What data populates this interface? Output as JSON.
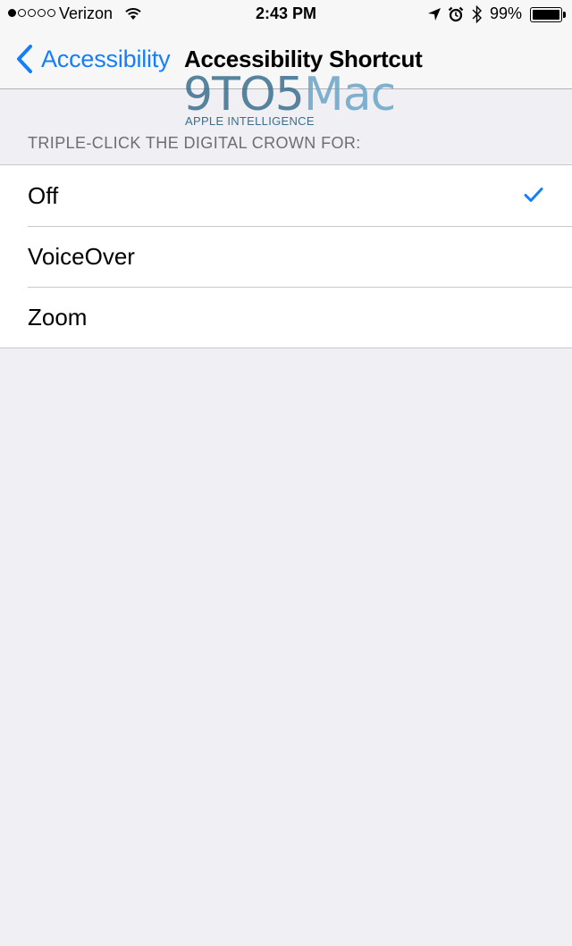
{
  "status_bar": {
    "carrier": "Verizon",
    "signal_bars_filled": 1,
    "signal_bars_total": 5,
    "time": "2:43 PM",
    "battery_percent": "99%",
    "battery_level": 0.99,
    "icons": [
      "signal-dots-icon",
      "wifi-icon",
      "location-arrow-icon",
      "alarm-clock-icon",
      "bluetooth-icon",
      "battery-icon"
    ]
  },
  "nav": {
    "back_label": "Accessibility",
    "title": "Accessibility Shortcut",
    "back_icon": "chevron-left-icon"
  },
  "watermark": {
    "main_prefix": "9TO5",
    "main_suffix": "Mac",
    "sub": "APPLE INTELLIGENCE"
  },
  "section": {
    "header": "TRIPLE-CLICK THE DIGITAL CROWN FOR:"
  },
  "options": [
    {
      "label": "Off",
      "selected": true
    },
    {
      "label": "VoiceOver",
      "selected": false
    },
    {
      "label": "Zoom",
      "selected": false
    }
  ],
  "colors": {
    "accent": "#147efb",
    "background": "#efeff4",
    "bar": "#f7f7f8",
    "separator": "#c8c7cc",
    "section_text": "#6d6d72"
  }
}
